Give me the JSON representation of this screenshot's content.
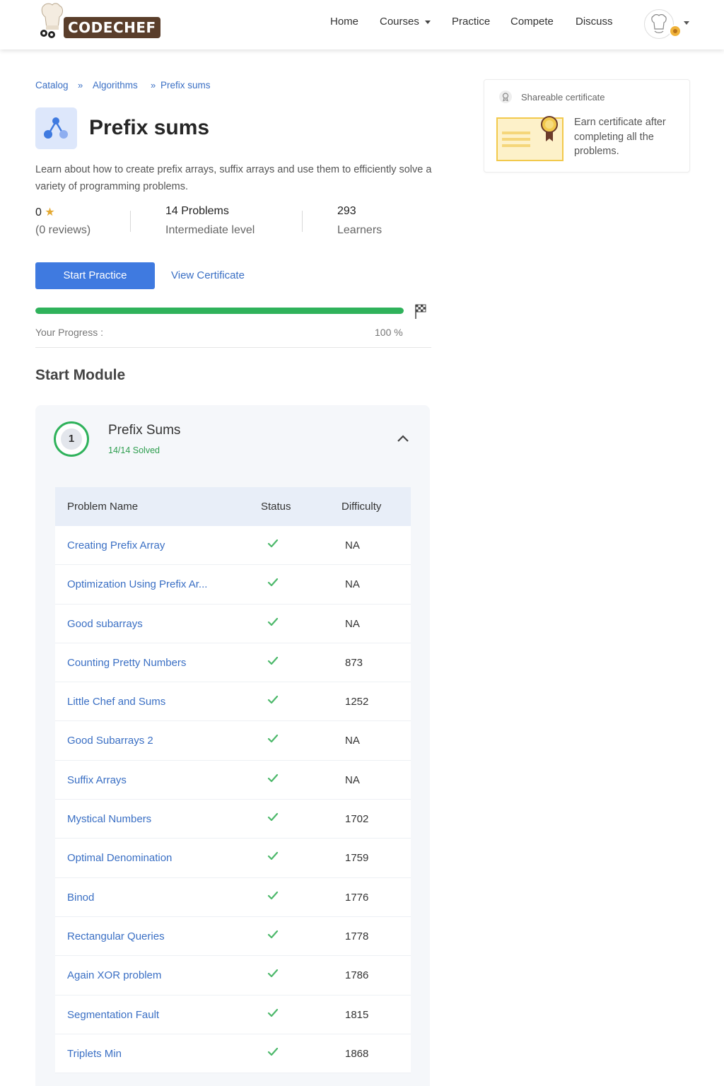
{
  "header": {
    "logo_text": "CODECHEF",
    "nav": [
      "Home",
      "Courses",
      "Practice",
      "Compete",
      "Discuss"
    ]
  },
  "breadcrumb": [
    "Catalog",
    "Algorithms",
    "Prefix sums"
  ],
  "breadcrumb_separator": "»",
  "course": {
    "title": "Prefix sums",
    "description": "Learn about how to create prefix arrays, suffix arrays and use them to efficiently solve a variety of programming problems.",
    "rating": "0",
    "reviews": "(0 reviews)",
    "problems": "14 Problems",
    "level": "Intermediate level",
    "learners_count": "293",
    "learners_label": "Learners"
  },
  "actions": {
    "start_practice": "Start Practice",
    "view_certificate": "View Certificate"
  },
  "progress": {
    "label": "Your Progress :",
    "percent_text": "100 %",
    "fraction": 1.0
  },
  "module_section_title": "Start Module",
  "module": {
    "number": "1",
    "title": "Prefix Sums",
    "solved": "14/14 Solved"
  },
  "table": {
    "headers": [
      "Problem Name",
      "Status",
      "Difficulty"
    ],
    "rows": [
      {
        "name": "Creating Prefix Array",
        "status": "✓",
        "difficulty": "NA"
      },
      {
        "name": "Optimization Using Prefix Ar...",
        "status": "✓",
        "difficulty": "NA"
      },
      {
        "name": "Good subarrays",
        "status": "✓",
        "difficulty": "NA"
      },
      {
        "name": "Counting Pretty Numbers",
        "status": "✓",
        "difficulty": "873"
      },
      {
        "name": "Little Chef and Sums",
        "status": "✓",
        "difficulty": "1252"
      },
      {
        "name": "Good Subarrays 2",
        "status": "✓",
        "difficulty": "NA"
      },
      {
        "name": "Suffix Arrays",
        "status": "✓",
        "difficulty": "NA"
      },
      {
        "name": "Mystical Numbers",
        "status": "✓",
        "difficulty": "1702"
      },
      {
        "name": "Optimal Denomination",
        "status": "✓",
        "difficulty": "1759"
      },
      {
        "name": "Binod",
        "status": "✓",
        "difficulty": "1776"
      },
      {
        "name": "Rectangular Queries",
        "status": "✓",
        "difficulty": "1778"
      },
      {
        "name": "Again XOR problem",
        "status": "✓",
        "difficulty": "1786"
      },
      {
        "name": "Segmentation Fault",
        "status": "✓",
        "difficulty": "1815"
      },
      {
        "name": "Triplets Min",
        "status": "✓",
        "difficulty": "1868"
      }
    ]
  },
  "certificate": {
    "heading": "Shareable certificate",
    "text": "Earn certificate after completing all the problems."
  },
  "colors": {
    "primary": "#3f7ae0",
    "link": "#3a6fc4",
    "success": "#2fb25b",
    "star": "#e4a932"
  }
}
